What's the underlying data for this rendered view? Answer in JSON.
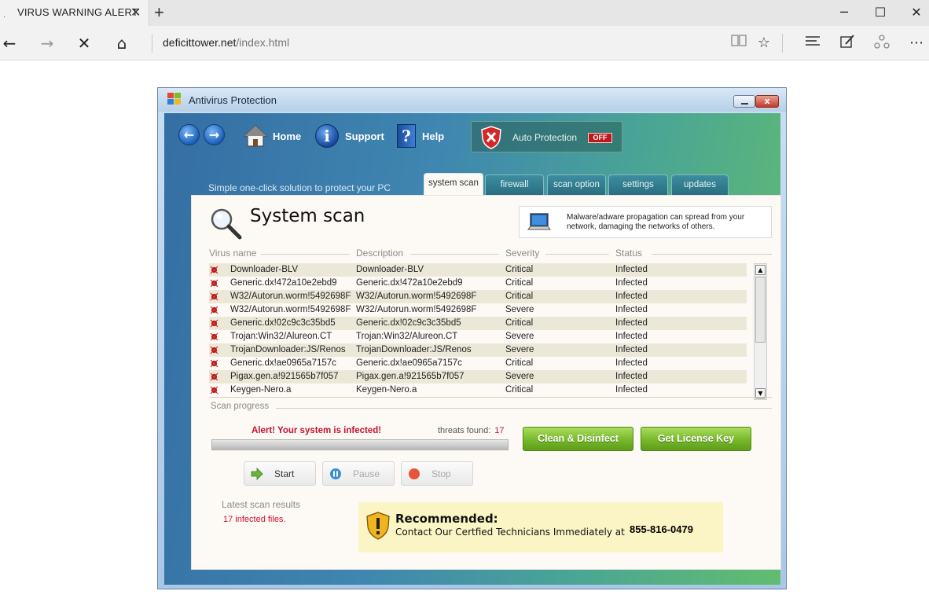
{
  "browser": {
    "tab_title": "VIRUS WARNING ALERT",
    "tab_favicon": ".",
    "tab_close": "✕",
    "new_tab": "+",
    "url_host": "deficittower.net",
    "url_path": "/index.html",
    "window_controls": {
      "minimize": "─",
      "maximize": "☐",
      "close": "✕"
    },
    "nav": {
      "back": "←",
      "forward": "→",
      "stop": "✕",
      "home": "⌂"
    },
    "toolbar_icons": [
      "reading-view-icon",
      "favorite-star-icon",
      "hub-icon",
      "web-note-icon",
      "share-icon",
      "more-icon"
    ]
  },
  "av": {
    "window_title": "Antivirus Protection",
    "nav": {
      "home": "Home",
      "support": "Support",
      "help": "Help",
      "support_glyph": "i",
      "help_glyph": "?",
      "back_glyph": "←",
      "forward_glyph": "→"
    },
    "auto_protection": {
      "label": "Auto Protection",
      "state": "OFF"
    },
    "tagline": "Simple one-click solution to protect your PC",
    "tabs": [
      "system scan",
      "firewall",
      "scan option",
      "settings",
      "updates"
    ],
    "panel_title": "System scan",
    "notice": "Malware/adware propagation can spread from your network, damaging the networks of others.",
    "columns": {
      "name": "Virus name",
      "description": "Description",
      "severity": "Severity",
      "status": "Status"
    },
    "rows": [
      {
        "name": "Downloader-BLV",
        "description": "Downloader-BLV",
        "severity": "Critical",
        "status": "Infected"
      },
      {
        "name": "Generic.dx!472a10e2ebd9",
        "description": "Generic.dx!472a10e2ebd9",
        "severity": "Critical",
        "status": "Infected"
      },
      {
        "name": "W32/Autorun.worm!5492698F",
        "description": "W32/Autorun.worm!5492698F",
        "severity": "Critical",
        "status": "Infected"
      },
      {
        "name": "W32/Autorun.worm!5492698F",
        "description": "W32/Autorun.worm!5492698F",
        "severity": "Severe",
        "status": "Infected"
      },
      {
        "name": "Generic.dx!02c9c3c35bd5",
        "description": "Generic.dx!02c9c3c35bd5",
        "severity": "Critical",
        "status": "Infected"
      },
      {
        "name": "Trojan:Win32/Alureon.CT",
        "description": "Trojan:Win32/Alureon.CT",
        "severity": "Severe",
        "status": "Infected"
      },
      {
        "name": "TrojanDownloader:JS/Renos",
        "description": "TrojanDownloader:JS/Renos",
        "severity": "Severe",
        "status": "Infected"
      },
      {
        "name": "Generic.dx!ae0965a7157c",
        "description": "Generic.dx!ae0965a7157c",
        "severity": "Critical",
        "status": "Infected"
      },
      {
        "name": "Pigax.gen.a!921565b7f057",
        "description": "Pigax.gen.a!921565b7f057",
        "severity": "Severe",
        "status": "Infected"
      },
      {
        "name": "Keygen-Nero.a",
        "description": "Keygen-Nero.a",
        "severity": "Critical",
        "status": "Infected"
      }
    ],
    "scan_progress_label": "Scan progress",
    "alert": "Alert! Your system is infected!",
    "threats_label": "threats found:",
    "threats_count": "17",
    "buttons": {
      "clean": "Clean & Disinfect",
      "license": "Get License Key",
      "start": "Start",
      "pause": "Pause",
      "stop": "Stop"
    },
    "latest_label": "Latest scan results",
    "infected_files": "17 infected files.",
    "recommend": {
      "title": "Recommended:",
      "text": "Contact Our Certfied Technicians Immediately at",
      "phone": "855-816-0479"
    }
  }
}
